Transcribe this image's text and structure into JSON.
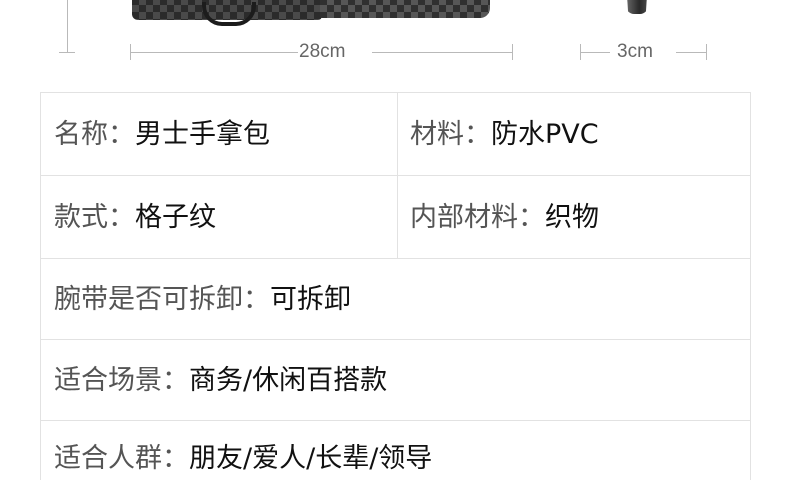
{
  "dimensions": {
    "length": "28cm",
    "depth": "3cm"
  },
  "specs": {
    "name": {
      "label": "名称：",
      "value": "男士手拿包"
    },
    "material": {
      "label": "材料：",
      "value": "防水PVC"
    },
    "style": {
      "label": "款式：",
      "value": "格子纹"
    },
    "inner_material": {
      "label": "内部材料：",
      "value": "织物"
    },
    "wrist_strap": {
      "label": "腕带是否可拆卸：",
      "value": "可拆卸"
    },
    "occasion": {
      "label": "适合场景：",
      "value": "商务/休闲百搭款"
    },
    "audience": {
      "label": "适合人群：",
      "value": "朋友/爱人/长辈/领导"
    }
  }
}
